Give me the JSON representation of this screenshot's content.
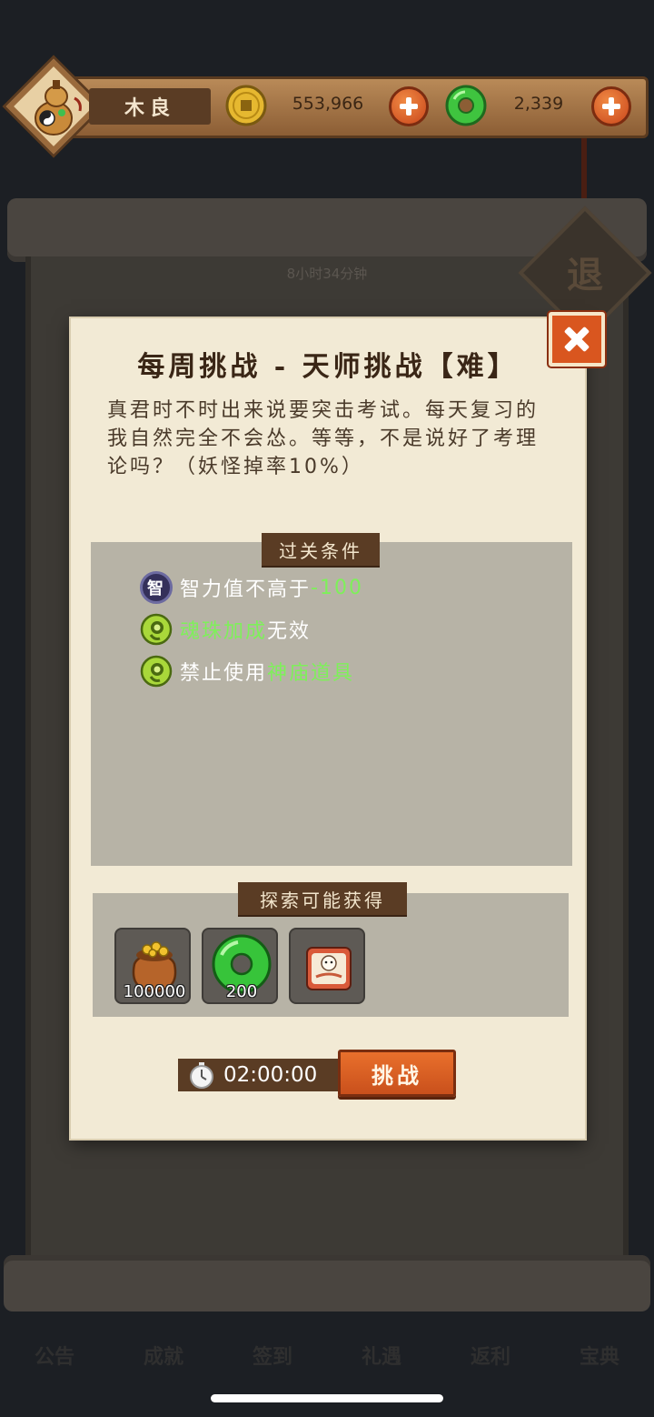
{
  "header": {
    "player_name": "木良",
    "coins": "553,966",
    "jade": "2,339"
  },
  "background": {
    "timer_text": "8小时34分钟",
    "retreat_label": "退",
    "nav": [
      "公告",
      "成就",
      "签到",
      "礼遇",
      "返利",
      "宝典"
    ]
  },
  "dialog": {
    "title": "每周挑战 - 天师挑战【难】",
    "description": "真君时不时出来说要突击考试。每天复习的我自然完全不会怂。等等，不是说好了考理论吗？（妖怪掉率10%）",
    "conditions_title": "过关条件",
    "conditions": [
      {
        "icon": "wisdom-icon",
        "badge": "智",
        "text": "智力值不高于",
        "highlight": "-100",
        "suffix": ""
      },
      {
        "icon": "soul-bead-icon",
        "badge": "",
        "text": "",
        "highlight": "魂珠加成",
        "suffix": "无效"
      },
      {
        "icon": "soul-bead-icon",
        "badge": "",
        "text": "禁止使用",
        "highlight": "神庙道具",
        "suffix": ""
      }
    ],
    "rewards_title": "探索可能获得",
    "rewards": [
      {
        "icon": "coin-bag-icon",
        "qty": "100000"
      },
      {
        "icon": "jade-icon",
        "qty": "200"
      },
      {
        "icon": "scroll-card-icon",
        "qty": ""
      }
    ],
    "timer": "02:00:00",
    "challenge_label": "挑战"
  },
  "colors": {
    "highlight_green": "#7ef05a",
    "button_orange": "#d9561f",
    "panel_gray": "#b7b3a6",
    "paper": "#f2ead5"
  }
}
